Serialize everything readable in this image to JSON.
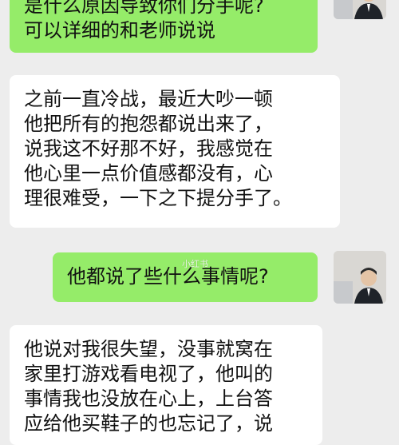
{
  "messages": [
    {
      "direction": "outgoing",
      "lines": [
        "是什么原因导致你们分手呢?",
        "可以详细的和老师说说"
      ]
    },
    {
      "direction": "incoming",
      "lines": [
        "之前一直冷战，最近大吵一顿",
        "他把所有的抱怨都说出来了，",
        "说我这不好那不好，我感觉在",
        "他心里一点价值感都没有，心",
        "理很难受，一下之下提分手了。"
      ]
    },
    {
      "direction": "outgoing",
      "lines": [
        "他都说了些什么事情呢?"
      ]
    },
    {
      "direction": "incoming",
      "lines": [
        "他说对我很失望，没事就窝在",
        "家里打游戏看电视了，他叫的",
        "事情我也没放在心上，上台答",
        "应给他买鞋子的也忘记了，说"
      ]
    }
  ],
  "watermark": "小红书",
  "colors": {
    "outgoing_bubble": "#95ec69",
    "incoming_bubble": "#ffffff",
    "background": "#ededed"
  }
}
